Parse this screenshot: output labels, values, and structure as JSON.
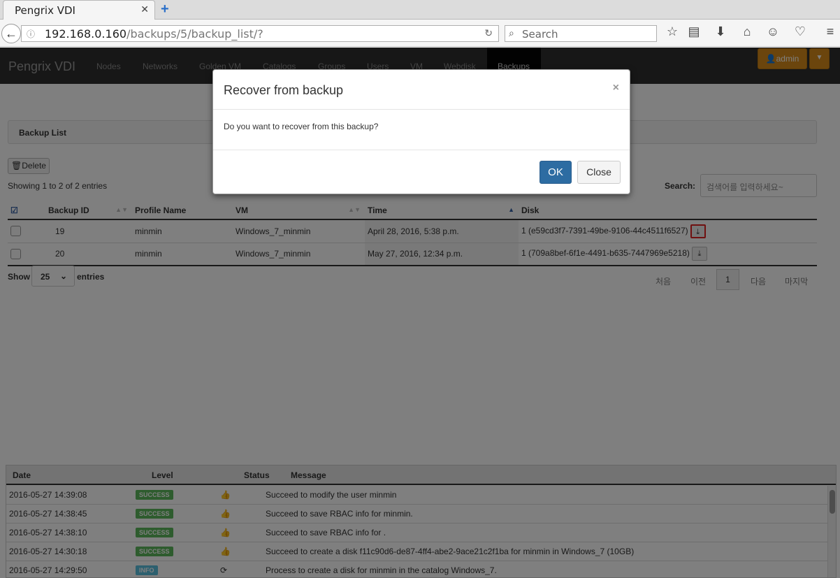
{
  "browser": {
    "tab_title": "Pengrix VDI",
    "url_host": "192.168.0.160",
    "url_path": "/backups/5/backup_list/?",
    "search_placeholder": "Search"
  },
  "app": {
    "brand": "Pengrix VDI",
    "nav": [
      "Nodes",
      "Networks",
      "Golden VM",
      "Catalogs",
      "Groups",
      "Users",
      "VM",
      "Webdisk",
      "Backups"
    ],
    "active_nav": "Backups",
    "user": "admin"
  },
  "backup_list": {
    "title": "Backup List",
    "delete_label": "Delete",
    "showing": "Showing 1 to 2 of 2 entries",
    "search_label": "Search:",
    "search_placeholder": "검색어를 입력하세요~",
    "columns": [
      "Backup ID",
      "Profile Name",
      "VM",
      "Time",
      "Disk"
    ],
    "rows": [
      {
        "id": "19",
        "profile": "minmin",
        "vm": "Windows_7_minmin",
        "time": "April 28, 2016, 5:38 p.m.",
        "disk": "1 (e59cd3f7-7391-49be-9106-44c4511f6527)"
      },
      {
        "id": "20",
        "profile": "minmin",
        "vm": "Windows_7_minmin",
        "time": "May 27, 2016, 12:34 p.m.",
        "disk": "1 (709a8bef-6f1e-4491-b635-7447969e5218)"
      }
    ],
    "show_label": "Show",
    "page_size": "25",
    "entries_label": "entries",
    "pager": {
      "first": "처음",
      "prev": "이전",
      "current": "1",
      "next": "다음",
      "last": "마지막"
    }
  },
  "log": {
    "columns": [
      "Date",
      "Level",
      "Status",
      "Message"
    ],
    "rows": [
      {
        "date": "2016-05-27 14:39:08",
        "level": "SUCCESS",
        "message": "Succeed to modify the user minmin"
      },
      {
        "date": "2016-05-27 14:38:45",
        "level": "SUCCESS",
        "message": "Succeed to save RBAC info for minmin."
      },
      {
        "date": "2016-05-27 14:38:10",
        "level": "SUCCESS",
        "message": "Succeed to save RBAC info for ."
      },
      {
        "date": "2016-05-27 14:30:18",
        "level": "SUCCESS",
        "message": "Succeed to create a disk f11c90d6-de87-4ff4-abe2-9ace21c2f1ba for minmin in Windows_7 (10GB)"
      },
      {
        "date": "2016-05-27 14:29:50",
        "level": "INFO",
        "message": "Process to create a disk for minmin in the catalog Windows_7."
      }
    ]
  },
  "modal": {
    "title": "Recover from backup",
    "close_x": "×",
    "message": "Do you want to recover from this backup?",
    "ok_label": "OK",
    "close_label": "Close"
  },
  "colors": {
    "primary": "#2d6ca2",
    "admin": "#d68b1a",
    "success": "#5cb85c",
    "info": "#5bc0de",
    "highlight": "#e02020"
  }
}
